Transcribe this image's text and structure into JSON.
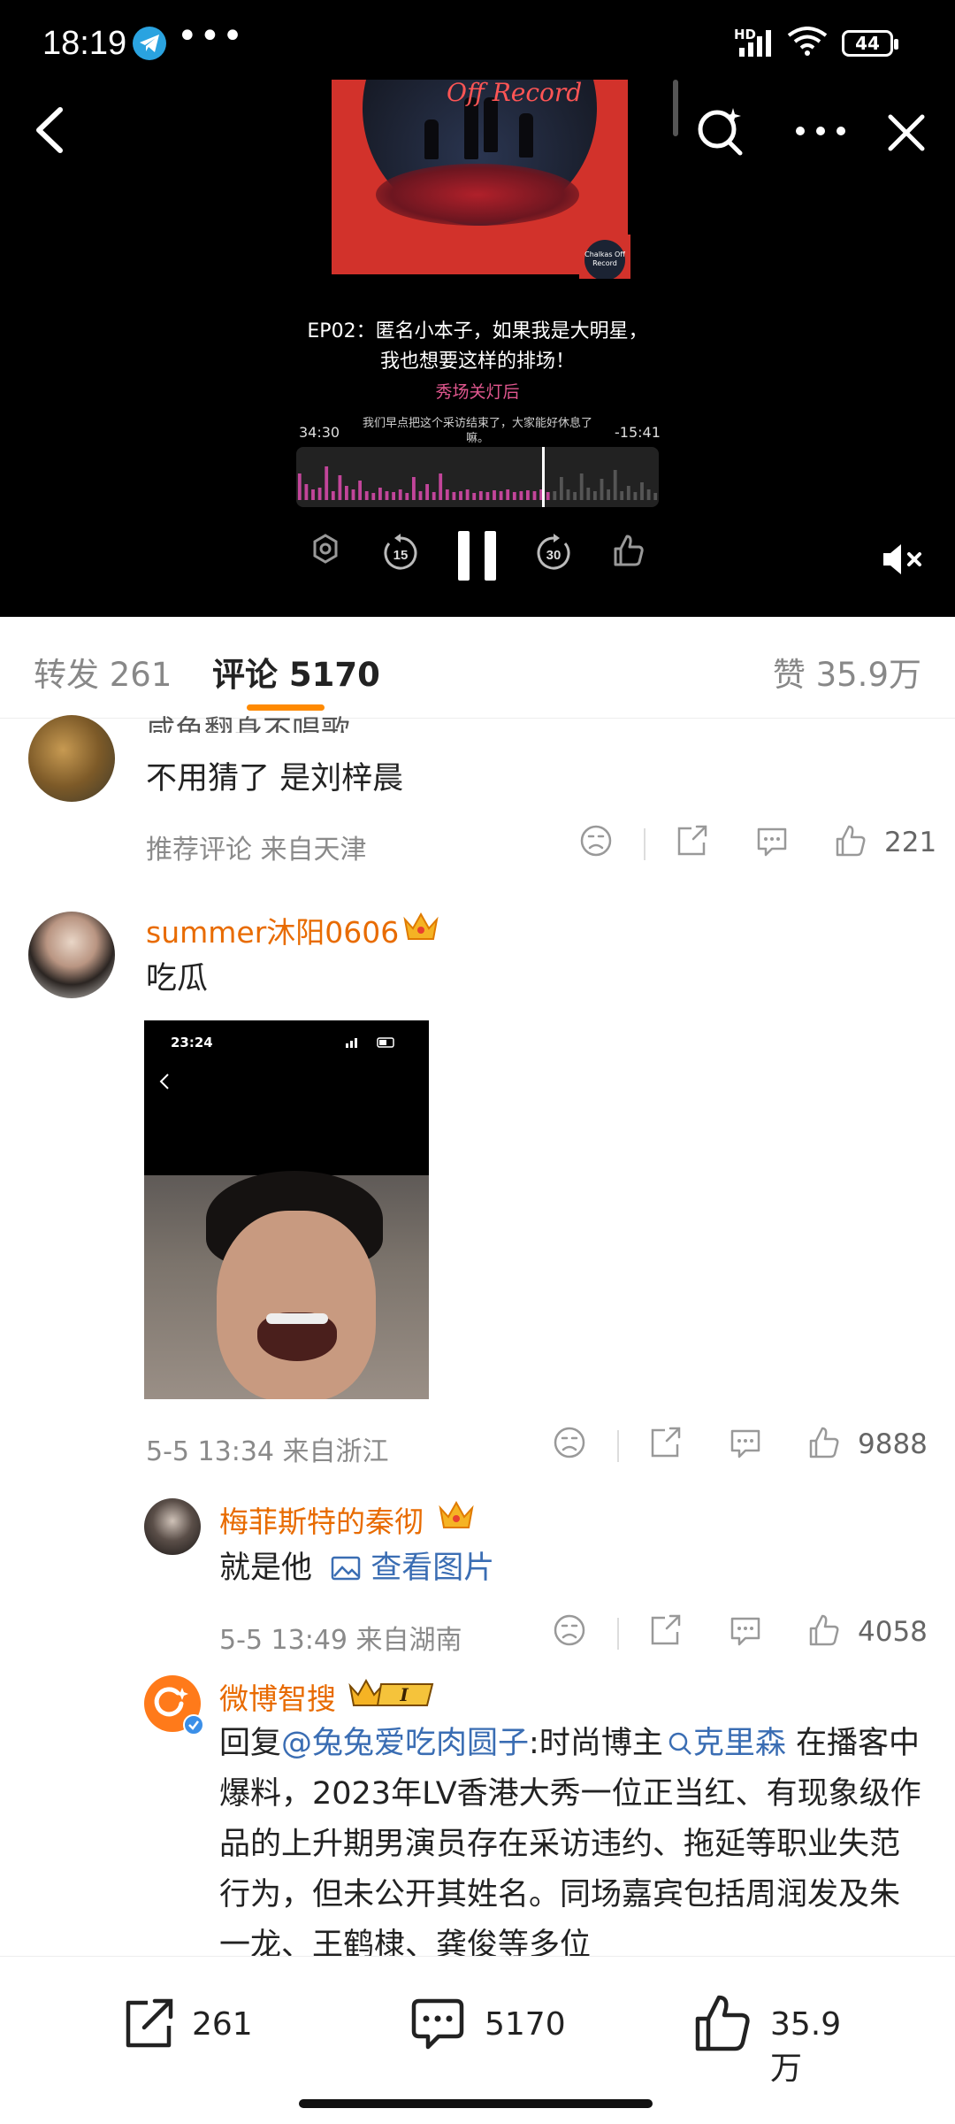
{
  "status_bar": {
    "time": "18:19",
    "overflow": "•••",
    "network": "HD",
    "battery": "44",
    "icons": [
      "telegram-icon",
      "signal-icon",
      "wifi-icon",
      "battery-icon"
    ]
  },
  "player": {
    "cover_title": "Off Record",
    "cover_badge": "Chalkas Off Record",
    "episode_title": "EP02：匿名小本子，如果我是大明星，我也想要这样的排场！",
    "show_name": "秀场关灯后",
    "elapsed": "34:30",
    "remaining": "-15:41",
    "lyric": "我们早点把这个采访结束了，大家能好休息了嘛。",
    "progress_fraction": 0.69,
    "accent_color": "#c2459a"
  },
  "tabs": {
    "repost": "转发 261",
    "comments": "评论 5170",
    "likes": "赞 35.9万",
    "accent_color": "#ff8a00"
  },
  "comments": [
    {
      "username": "咸鱼翻身不唱歌",
      "text": "不用猜了 是刘梓晨",
      "meta": "推荐评论  来自天津",
      "likes": "221"
    },
    {
      "username": "summer沐阳0606",
      "text": "吃瓜",
      "meta": "5-5 13:34  来自浙江",
      "likes": "9888",
      "image_status_time": "23:24"
    }
  ],
  "replies": [
    {
      "username": "梅菲斯特的秦彻",
      "text": "就是他",
      "link": "查看图片",
      "meta": "5-5 13:49  来自湖南",
      "likes": "4058"
    },
    {
      "username": "微博智搜",
      "badge": "I",
      "reply_prefix": "回复",
      "mention": "@兔兔爱吃肉圆子",
      "text_a": ":时尚博主",
      "search_term": "克里森",
      "text_b": " 在播客中爆料，2023年LV香港大秀一位正当红、有现象级作品的上升期男演员存在采访违约、拖延等职业失范行为，但未公开其姓名。同场嘉宾包括周润发及朱一龙、王鹤棣、龚俊等多位"
    }
  ],
  "bottom_bar": {
    "repost_count": "261",
    "comment_count": "5170",
    "like_count": "35.9万"
  }
}
